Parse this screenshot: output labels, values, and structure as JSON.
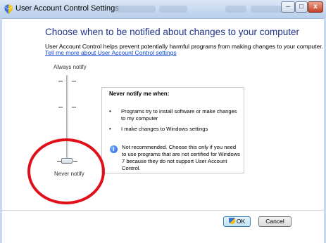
{
  "window": {
    "title": "User Account Control Settings",
    "minimize_glyph": "–",
    "maximize_glyph": "□",
    "close_glyph": "x"
  },
  "main": {
    "heading": "Choose when to be notified about changes to your computer",
    "description": "User Account Control helps prevent potentially harmful programs from making changes to your computer.",
    "link": "Tell me more about User Account Control settings"
  },
  "slider": {
    "top_label": "Always notify",
    "bottom_label": "Never notify",
    "level": 0,
    "levels_count": 4
  },
  "info": {
    "title": "Never notify me when:",
    "bullets": [
      "Programs try to install software or make changes to my computer",
      "I make changes to Windows settings"
    ],
    "bullet_glyph": "•",
    "warning_icon": "info-icon",
    "warning_glyph": "i",
    "warning": "Not recommended. Choose this only if you need to use programs that are not certified for Windows 7 because they do not support User Account Control."
  },
  "footer": {
    "ok_label": "OK",
    "cancel_label": "Cancel",
    "ok_icon": "shield-icon"
  },
  "colors": {
    "heading": "#1e3287",
    "link": "#0b47d1",
    "annotation": "#e0101a"
  }
}
